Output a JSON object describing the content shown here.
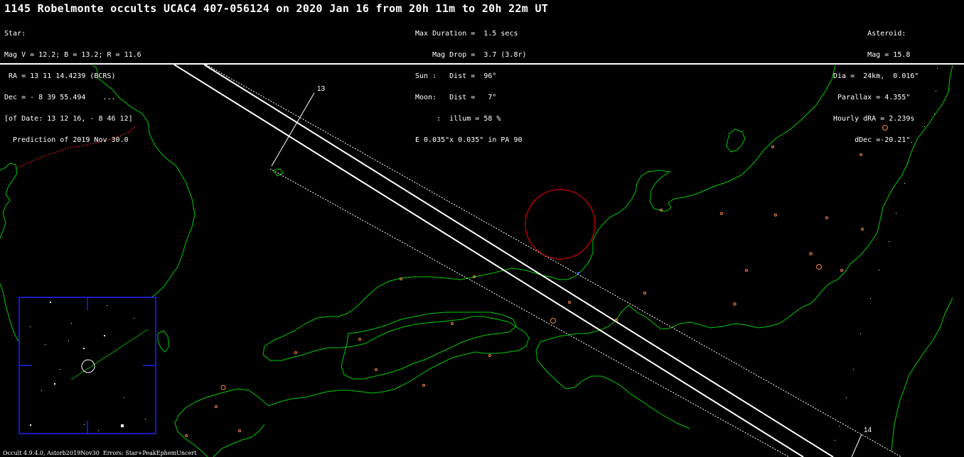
{
  "title": "1145 Robelmonte occults UCAC4 407-056124 on 2020 Jan 16 from 20h 11m to 20h 22m UT",
  "star_block": [
    "Star:",
    "Mag V = 12.2; B = 13.2; R = 11.6",
    " RA = 13 11 14.4239 (BCRS)",
    "Dec = - 8 39 55.494    ...",
    "[of Date: 13 12 16, - 8 46 12]",
    "  Prediction of 2019 Nov 30.0"
  ],
  "event_block": [
    "Max Duration =  1.5 secs",
    "    Mag Drop =  3.7 (3.8r)",
    "Sun :   Dist =  96°",
    "Moon:   Dist =   7°",
    "     :  illum = 58 %",
    "E 0.035\"x 0.035\" in PA 90"
  ],
  "asteroid_block": [
    "Asteroid:   ",
    "Mag = 15.8  ",
    "Dia =  24km,  0.016\"",
    "Parallax = 4.355\"  ",
    "Hourly dRA = 2.239s ",
    "dDec =-20.21\"  "
  ],
  "path_labels": {
    "start": "13",
    "end": "14"
  },
  "footer": "Occult 4.9.4.0, Astorb2019Nov30  Errors: Star+PeakEphemUncert",
  "colors": {
    "background": "#000000",
    "coastline": "#00cc00",
    "path_lines": "#ffffff",
    "cities": "#ff8844",
    "uncertainty_circle": "#ff0000",
    "border": "#ff2222",
    "finder_frame": "#2020ff"
  }
}
